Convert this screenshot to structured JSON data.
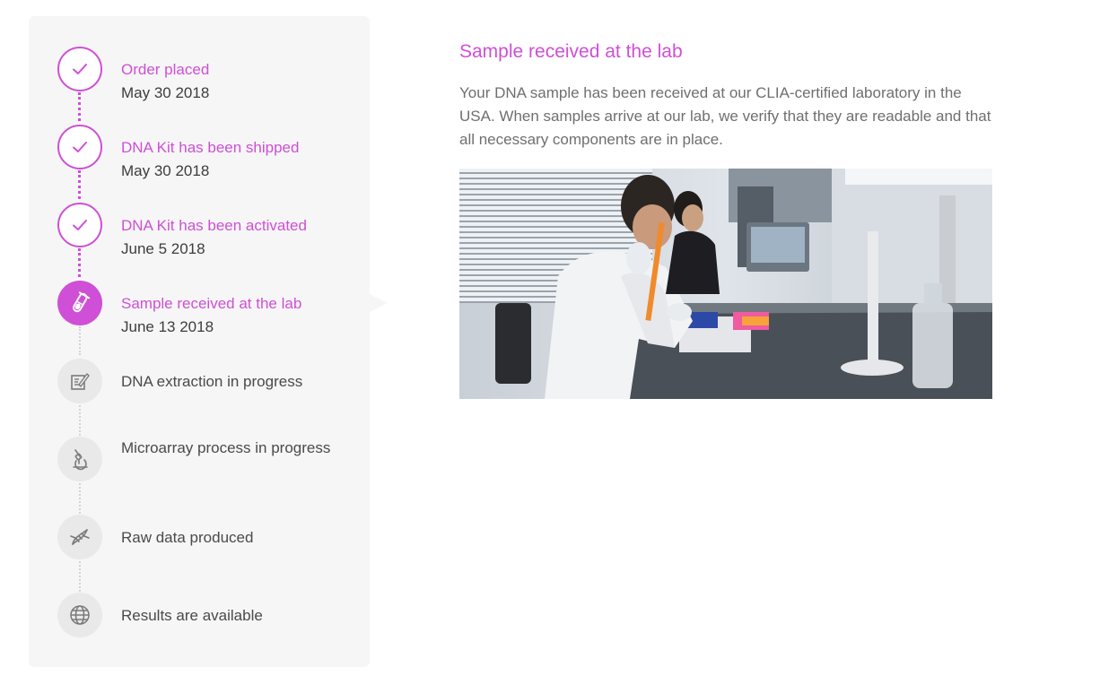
{
  "timeline": {
    "steps": [
      {
        "title": "Order placed",
        "date": "May 30 2018",
        "status": "done",
        "icon": "check-icon"
      },
      {
        "title": "DNA Kit has been shipped",
        "date": "May 30 2018",
        "status": "done",
        "icon": "check-icon"
      },
      {
        "title": "DNA Kit has been activated",
        "date": "June 5 2018",
        "status": "done",
        "icon": "check-icon"
      },
      {
        "title": "Sample received at the lab",
        "date": "June 13 2018",
        "status": "current",
        "icon": "test-tube-icon"
      },
      {
        "title": "DNA extraction in progress",
        "status": "pending",
        "icon": "edit-document-icon"
      },
      {
        "title": "Microarray process in progress",
        "status": "pending",
        "icon": "microscope-icon"
      },
      {
        "title": "Raw data produced",
        "status": "pending",
        "icon": "dna-helix-icon"
      },
      {
        "title": "Results are available",
        "status": "pending",
        "icon": "globe-icon"
      }
    ]
  },
  "detail": {
    "title": "Sample received at the lab",
    "body": "Your DNA sample has been received at our CLIA-certified laboratory in the USA. When samples arrive at our lab, we verify that they are readable and that all necessary components are in place.",
    "image_icon": "lab-photo"
  },
  "colors": {
    "accent": "#cf4fd7",
    "panel_bg": "#f6f6f6",
    "pending_icon_bg": "#e9e9e9",
    "body_text": "#6f6f6f"
  }
}
